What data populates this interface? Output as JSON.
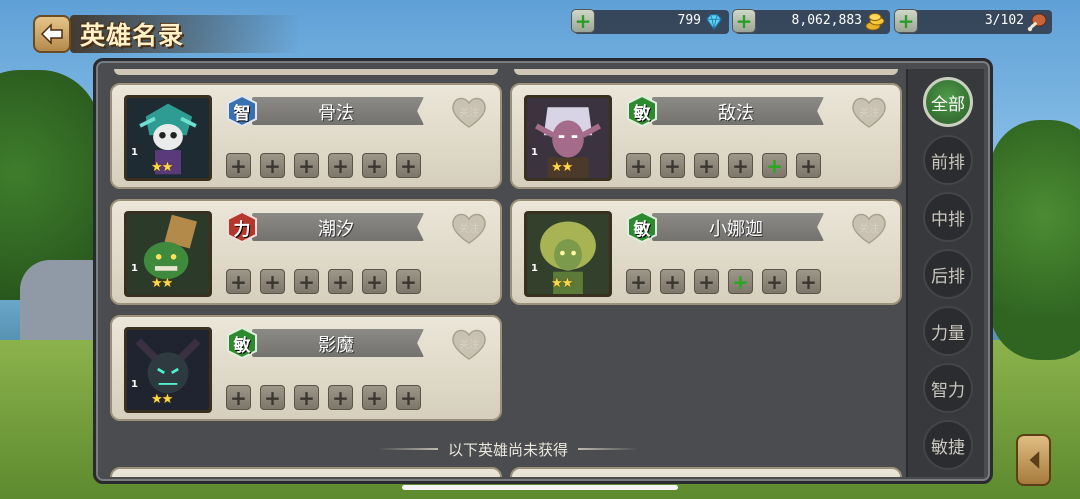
{
  "header": {
    "title": "英雄名录"
  },
  "resources": [
    {
      "value": "799",
      "icon": "diamond-icon"
    },
    {
      "value": "8,062,883",
      "icon": "gold-coins-icon"
    },
    {
      "value": "3/102",
      "icon": "meat-drumstick-icon"
    }
  ],
  "heroes": [
    {
      "name": "骨法",
      "attribute": "智",
      "attr_type": "intelligence",
      "level": "1",
      "stars": "★★",
      "follow": "关注",
      "portrait": "skeleton-mage-portrait",
      "green_slots": []
    },
    {
      "name": "敌法",
      "attribute": "敏",
      "attr_type": "agility",
      "level": "1",
      "stars": "★★",
      "follow": "关注",
      "portrait": "elf-warrior-portrait",
      "green_slots": [
        4
      ]
    },
    {
      "name": "潮汐",
      "attribute": "力",
      "attr_type": "strength",
      "level": "1",
      "stars": "★★",
      "follow": "关注",
      "portrait": "sea-creature-portrait",
      "green_slots": []
    },
    {
      "name": "小娜迦",
      "attribute": "敏",
      "attr_type": "agility",
      "level": "1",
      "stars": "★★",
      "follow": "关注",
      "portrait": "naga-portrait",
      "green_slots": [
        3
      ]
    },
    {
      "name": "影魔",
      "attribute": "敏",
      "attr_type": "agility",
      "level": "1",
      "stars": "★★",
      "follow": "关注",
      "portrait": "shadow-demon-portrait",
      "green_slots": []
    }
  ],
  "divider_text": "以下英雄尚未获得",
  "filters": [
    "全部",
    "前排",
    "中排",
    "后排",
    "力量",
    "智力",
    "敏捷"
  ],
  "active_filter": 0,
  "colors": {
    "intelligence": "#3a6fb0",
    "agility": "#2e8a2e",
    "strength": "#b5372c"
  }
}
